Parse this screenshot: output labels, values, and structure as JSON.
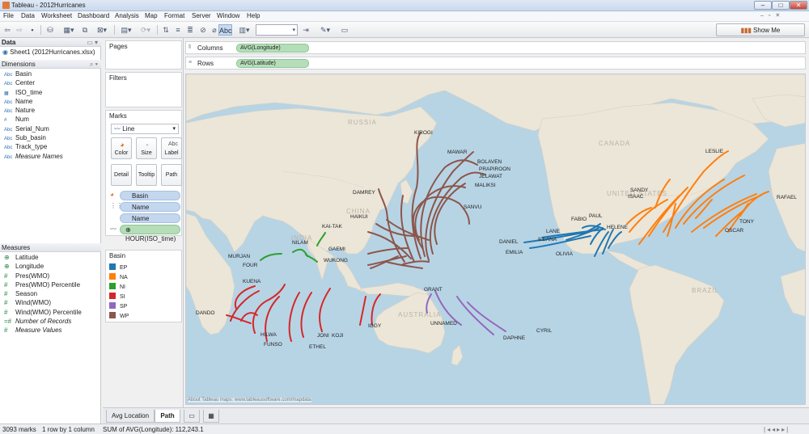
{
  "window": {
    "title": "Tableau - 2012Hurricanes"
  },
  "menu": [
    "File",
    "Data",
    "Worksheet",
    "Dashboard",
    "Analysis",
    "Map",
    "Format",
    "Server",
    "Window",
    "Help"
  ],
  "toolbar": {
    "show_me": "Show Me",
    "abc": "Abc"
  },
  "data_pane": {
    "header": "Data",
    "source": "Sheet1 (2012Hurricanes.xlsx)",
    "dimensions_header": "Dimensions",
    "dimensions": [
      {
        "icon": "Abc",
        "name": "Basin"
      },
      {
        "icon": "Abc",
        "name": "Center"
      },
      {
        "icon": "cal",
        "name": "ISO_time"
      },
      {
        "icon": "Abc",
        "name": "Name"
      },
      {
        "icon": "Abc",
        "name": "Nature"
      },
      {
        "icon": "#",
        "name": "Num"
      },
      {
        "icon": "Abc",
        "name": "Serial_Num"
      },
      {
        "icon": "Abc",
        "name": "Sub_basin"
      },
      {
        "icon": "Abc",
        "name": "Track_type"
      },
      {
        "icon": "Abc",
        "name": "Measure Names"
      }
    ],
    "measures_header": "Measures",
    "measures": [
      {
        "icon": "⊕",
        "name": "Latitude"
      },
      {
        "icon": "⊕",
        "name": "Longitude"
      },
      {
        "icon": "#",
        "name": "Pres(WMO)"
      },
      {
        "icon": "#",
        "name": "Pres(WMO) Percentile"
      },
      {
        "icon": "#",
        "name": "Season"
      },
      {
        "icon": "#",
        "name": "Wind(WMO)"
      },
      {
        "icon": "#",
        "name": "Wind(WMO) Percentile"
      },
      {
        "icon": "=#",
        "name": "Number of Records"
      },
      {
        "icon": "#",
        "name": "Measure Values"
      }
    ]
  },
  "cards": {
    "pages": "Pages",
    "filters": "Filters",
    "marks": "Marks",
    "mark_type": "Line",
    "buttons": [
      "Color",
      "Size",
      "Label",
      "Detail",
      "Tooltip",
      "Path"
    ],
    "pills": [
      "Basin",
      "Name",
      "Name",
      "HOUR(ISO_time)"
    ],
    "legend_title": "Basin",
    "legend": [
      {
        "code": "EP",
        "color": "#1f77b4"
      },
      {
        "code": "NA",
        "color": "#ff7f0e"
      },
      {
        "code": "NI",
        "color": "#2ca02c"
      },
      {
        "code": "SI",
        "color": "#d62728"
      },
      {
        "code": "SP",
        "color": "#9467bd"
      },
      {
        "code": "WP",
        "color": "#8c564b"
      }
    ]
  },
  "shelves": {
    "columns_label": "Columns",
    "columns_pill": "AVG(Longitude)",
    "rows_label": "Rows",
    "rows_pill": "AVG(Latitude)"
  },
  "map": {
    "attribution": "About Tableau maps: www.tableausoftware.com/mapdata",
    "regions": [
      "RUSSIA",
      "CANADA",
      "UNITED STATES",
      "CHINA",
      "INDIA",
      "AUSTRALIA",
      "BRAZIL"
    ],
    "storms": [
      "KIROGI",
      "MAWAR",
      "BOLAVEN",
      "PRAPIROON",
      "JELAWAT",
      "MALIKSI",
      "DAMREY",
      "SANVU",
      "HAIKUI",
      "KAI-TAK",
      "GAEMI",
      "WUKONG",
      "NILAM",
      "MURJAN",
      "FOUR",
      "KUENA",
      "DANDO",
      "HILWA",
      "FUNSO",
      "ETHEL",
      "JONI",
      "KOJI",
      "IGGY",
      "GRANT",
      "UNNAMED",
      "DAPHNE",
      "CYRIL",
      "DANIEL",
      "EMILIA",
      "LANE",
      "ILEANA",
      "OLIVIA",
      "FABIO",
      "PAUL",
      "HELENE",
      "SANDY",
      "ISAAC",
      "LESLIE",
      "RAFAEL",
      "TONY",
      "OSCAR"
    ]
  },
  "tabs": [
    "Avg Location",
    "Path"
  ],
  "status": {
    "marks": "3093 marks",
    "dims": "1 row by 1 column",
    "sum": "SUM of AVG(Longitude): 112,243.1"
  }
}
